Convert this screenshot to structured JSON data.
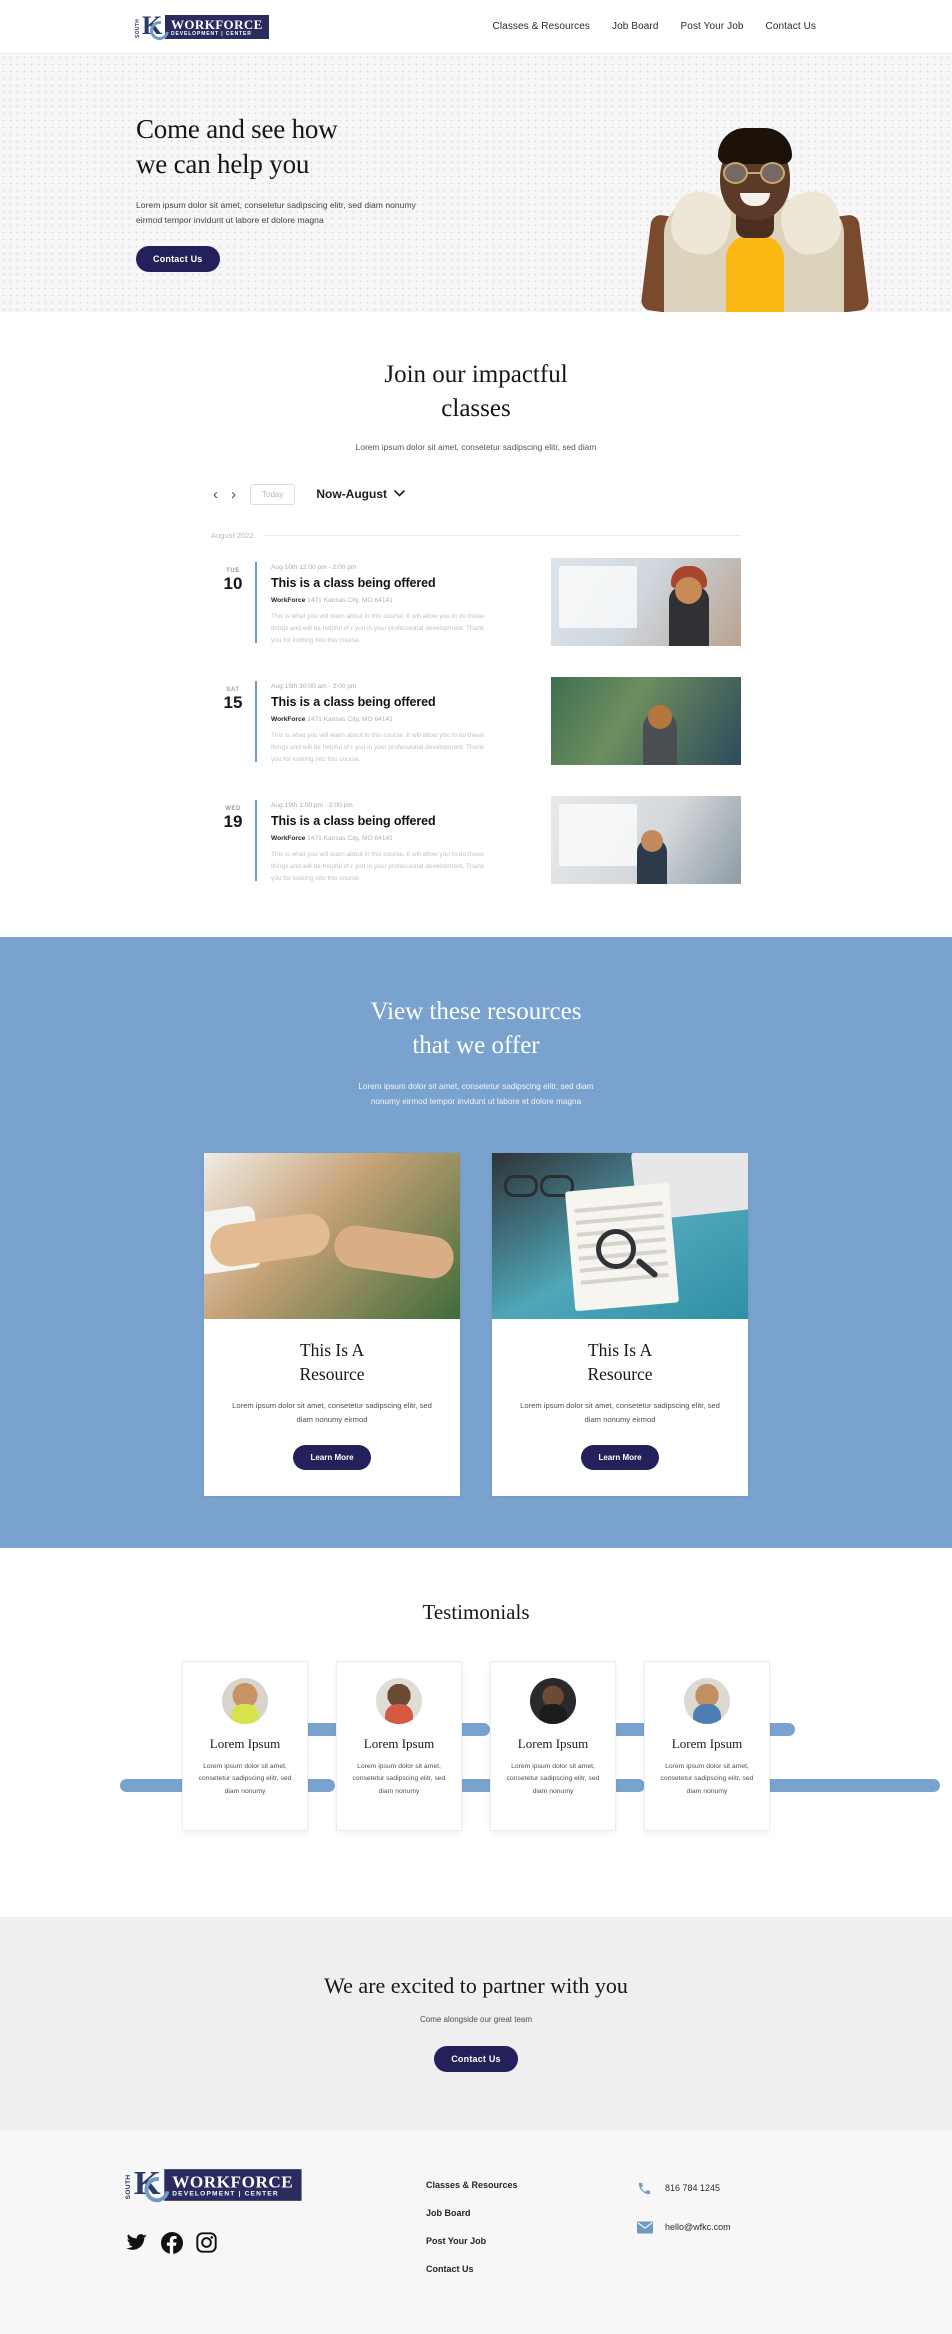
{
  "header": {
    "logo": {
      "south": "SOUTH",
      "kc": "KC",
      "workforce": "WORKFORCE",
      "center": "DEVELOPMENT | CENTER"
    },
    "nav": [
      {
        "label": "Classes & Resources"
      },
      {
        "label": "Job Board"
      },
      {
        "label": "Post Your Job"
      },
      {
        "label": "Contact Us"
      }
    ]
  },
  "hero": {
    "title_line1": "Come and see how",
    "title_line2": "we can help you",
    "subtitle": "Lorem ipsum dolor sit amet, consetetur sadipscing elitr, sed diam nonumy eirmod tempor invidunt ut labore et dolore magna",
    "cta_label": "Contact Us"
  },
  "classes": {
    "title_line1": "Join our impactful",
    "title_line2": "classes",
    "subtitle": "Lorem ipsum dolor sit amet, consetetur sadipscing elitr, sed diam",
    "toolbar": {
      "prev": "‹",
      "next": "›",
      "today_label": "Today",
      "range_label": "Now-August",
      "chevron": "⌄"
    },
    "month_label": "August 2022",
    "events": [
      {
        "dow": "TUE",
        "day": "10",
        "time": "Aug 10th 12:00 pm - 2:00 pm",
        "title": "This is a class being offered",
        "venue_name": "WorkForce",
        "venue_address": "1471 Kansas City, MO 64141",
        "description": "This is what you will learn about in this course. It will allow you to do these things and will be helpful of r you in your professional development. Thank you for looking into this course."
      },
      {
        "dow": "SAT",
        "day": "15",
        "time": "Aug 15th 10:00 am - 2:00 pm",
        "title": "This is a class being offered",
        "venue_name": "WorkForce",
        "venue_address": "1471 Kansas City, MO 64141",
        "description": "This is what you will learn about in this course. It will allow you to do these things and will be helpful of r you in your professional development. Thank you for looking into this course."
      },
      {
        "dow": "WED",
        "day": "19",
        "time": "Aug 19th 1:00 pm - 2:00 pm",
        "title": "This is a class being offered",
        "venue_name": "WorkForce",
        "venue_address": "1471 Kansas City, MO 64141",
        "description": "This is what you will learn about in this course. It will allow you to do these things and will be helpful of r you in your professional development. Thank you for looking into this course."
      }
    ]
  },
  "resources": {
    "title_line1": "View these resources",
    "title_line2": "that we offer",
    "subtitle_line1": "Lorem ipsum dolor sit amet, consetetur sadipscing elitr, sed diam",
    "subtitle_line2": "nonumy eirmod tempor invidunt ut labore et dolore magna",
    "cards": [
      {
        "title_line1": "This Is A",
        "title_line2": "Resource",
        "description": "Lorem ipsum dolor sit amet, consetetur sadipscing elitr, sed diam nonumy eirmod",
        "button_label": "Learn More"
      },
      {
        "title_line1": "This Is A",
        "title_line2": "Resource",
        "description": "Lorem ipsum dolor sit amet, consetetur sadipscing elitr, sed diam nonumy eirmod",
        "button_label": "Learn More"
      }
    ]
  },
  "testimonials": {
    "title": "Testimonials",
    "items": [
      {
        "name": "Lorem Ipsum",
        "text": "Lorem ipsum dolor sit amet, consetetur sadipscing elitr, sed diam nonumy"
      },
      {
        "name": "Lorem Ipsum",
        "text": "Lorem ipsum dolor sit amet, consetetur sadipscing elitr, sed diam nonumy"
      },
      {
        "name": "Lorem Ipsum",
        "text": "Lorem ipsum dolor sit amet, consetetur sadipscing elitr, sed diam nonumy"
      },
      {
        "name": "Lorem Ipsum",
        "text": "Lorem ipsum dolor sit amet, consetetur sadipscing elitr, sed diam nonumy"
      }
    ]
  },
  "cta": {
    "title": "We are excited to partner with you",
    "subtitle": "Come alongside our great team",
    "button_label": "Contact Us"
  },
  "footer": {
    "logo": {
      "south": "SOUTH",
      "workforce": "WORKFORCE",
      "center": "DEVELOPMENT | CENTER"
    },
    "social": [
      "twitter-icon",
      "facebook-icon",
      "instagram-icon"
    ],
    "links": [
      {
        "label": "Classes & Resources"
      },
      {
        "label": "Job Board"
      },
      {
        "label": "Post Your Job"
      },
      {
        "label": "Contact Us"
      }
    ],
    "phone": "816 784 1245",
    "email": "hello@wfkc.com"
  },
  "colors": {
    "navy": "#24205a",
    "blue": "#79a3ce",
    "logo_navy": "#2b2b5f",
    "light_gray": "#efefef"
  }
}
